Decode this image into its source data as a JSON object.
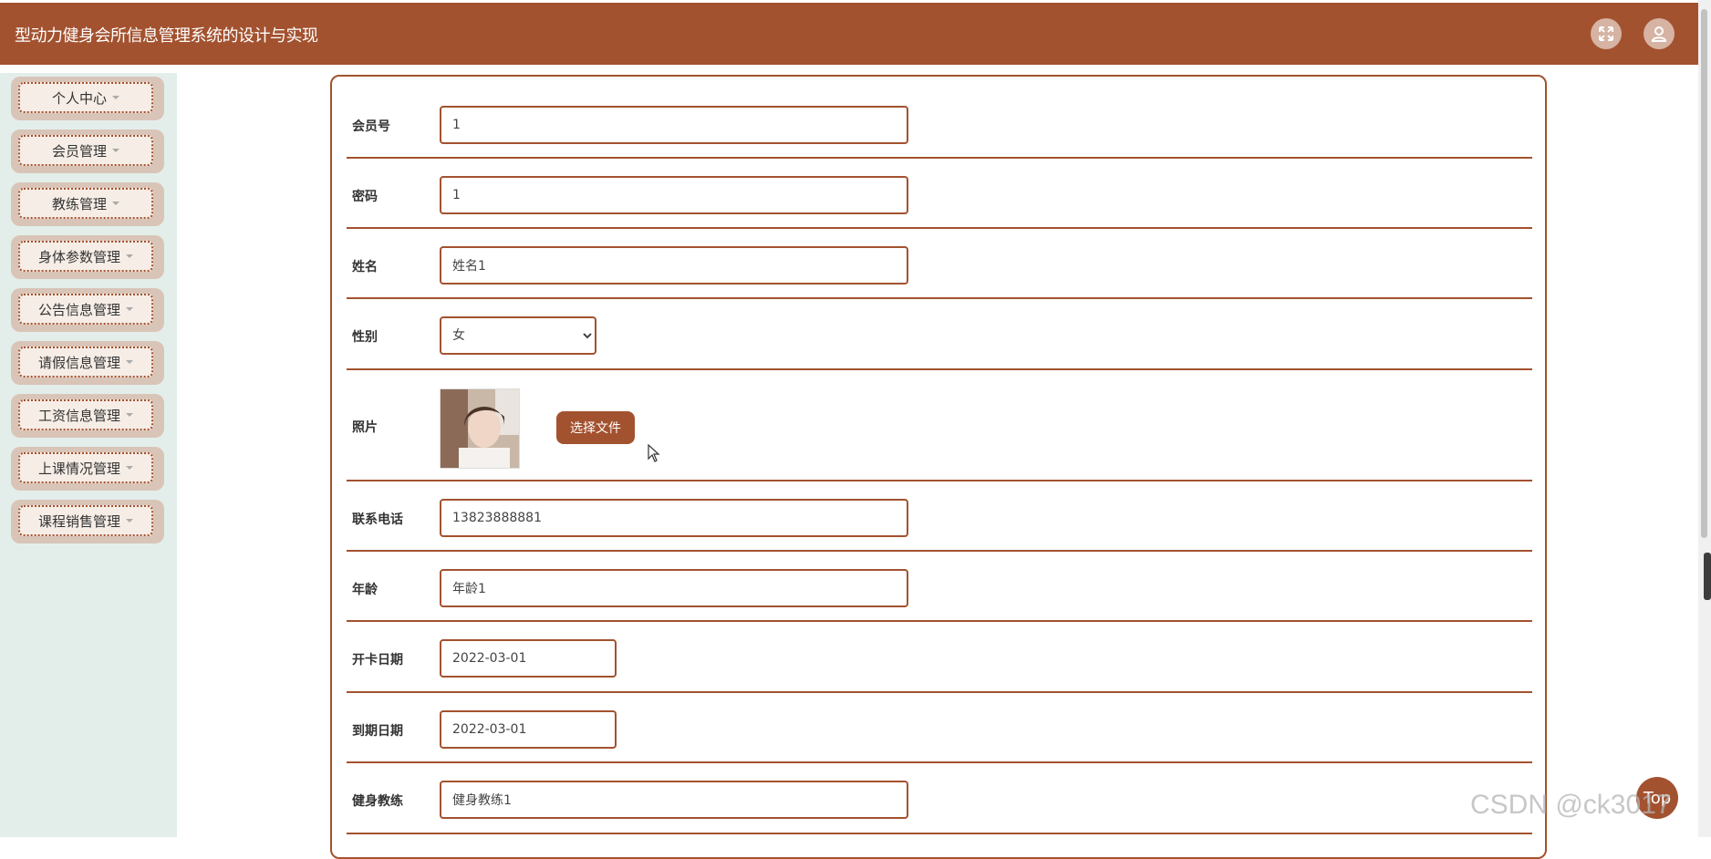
{
  "header": {
    "title": "型动力健身会所信息管理系统的设计与实现",
    "fullscreen_icon": "expand-icon",
    "user_icon": "user-icon"
  },
  "sidebar": {
    "items": [
      {
        "label": "个人中心"
      },
      {
        "label": "会员管理"
      },
      {
        "label": "教练管理"
      },
      {
        "label": "身体参数管理"
      },
      {
        "label": "公告信息管理"
      },
      {
        "label": "请假信息管理"
      },
      {
        "label": "工资信息管理"
      },
      {
        "label": "上课情况管理"
      },
      {
        "label": "课程销售管理"
      }
    ]
  },
  "form": {
    "member_no": {
      "label": "会员号",
      "value": "1"
    },
    "password": {
      "label": "密码",
      "value": "1"
    },
    "name": {
      "label": "姓名",
      "value": "姓名1"
    },
    "gender": {
      "label": "性别",
      "value": "女"
    },
    "photo": {
      "label": "照片",
      "button": "选择文件"
    },
    "phone": {
      "label": "联系电话",
      "value": "13823888881"
    },
    "age": {
      "label": "年龄",
      "value": "年龄1"
    },
    "open_date": {
      "label": "开卡日期",
      "value": "2022-03-01"
    },
    "expire_date": {
      "label": "到期日期",
      "value": "2022-03-01"
    },
    "coach": {
      "label": "健身教练",
      "value": "健身教练1"
    }
  },
  "fab": {
    "label": "Top"
  },
  "watermark": "CSDN @ck3017",
  "colors": {
    "brand": "#a3522f",
    "sidebar_bg": "#e3eeea"
  }
}
